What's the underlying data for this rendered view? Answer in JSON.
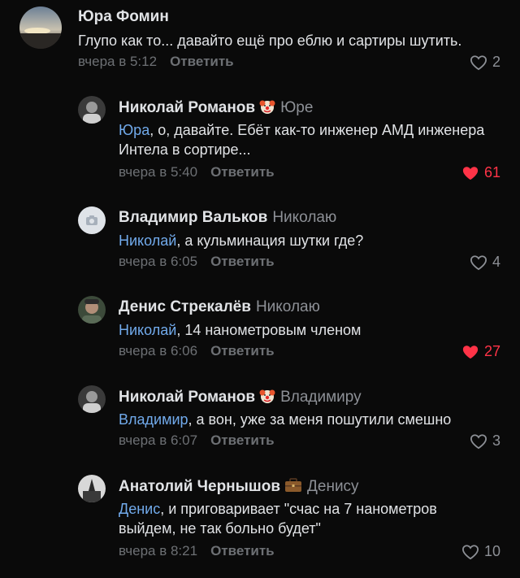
{
  "comments": [
    {
      "author": "Юра Фомин",
      "reply_to": "",
      "mention": "",
      "text": "Глупо как то... давайто ещё про еблю и сартиры шутить.",
      "time": "вчера в 5:12",
      "reply_label": "Ответить",
      "likes": "2",
      "liked": false,
      "badge": ""
    },
    {
      "author": "Николай Романов",
      "reply_to": "Юре",
      "mention": "Юра",
      "text": ", о, давайте. Ебёт как-то инженер АМД инженера Интела в сортире...",
      "time": "вчера в 5:40",
      "reply_label": "Ответить",
      "likes": "61",
      "liked": true,
      "badge": "clown-icon"
    },
    {
      "author": "Владимир Вальков",
      "reply_to": "Николаю",
      "mention": "Николай",
      "text": ", а кульминация шутки где?",
      "time": "вчера в 6:05",
      "reply_label": "Ответить",
      "likes": "4",
      "liked": false,
      "badge": ""
    },
    {
      "author": "Денис Стрекалёв",
      "reply_to": "Николаю",
      "mention": "Николай",
      "text": ", 14 нанометровым членом",
      "time": "вчера в 6:06",
      "reply_label": "Ответить",
      "likes": "27",
      "liked": true,
      "badge": ""
    },
    {
      "author": "Николай Романов",
      "reply_to": "Владимиру",
      "mention": "Владимир",
      "text": ", а вон, уже за меня пошутили смешно",
      "time": "вчера в 6:07",
      "reply_label": "Ответить",
      "likes": "3",
      "liked": false,
      "badge": "clown-icon"
    },
    {
      "author": "Анатолий Чернышов",
      "reply_to": "Денису",
      "mention": "Денис",
      "text": ", и приговаривает \"счас на 7 нанометров выйдем, не так больно будет\"",
      "time": "вчера в 8:21",
      "reply_label": "Ответить",
      "likes": "10",
      "liked": false,
      "badge": "briefcase-icon"
    }
  ],
  "colors": {
    "background": "#0a0a0a",
    "mention": "#71aaeb",
    "liked": "#ff3347",
    "secondary": "#6d7074"
  }
}
